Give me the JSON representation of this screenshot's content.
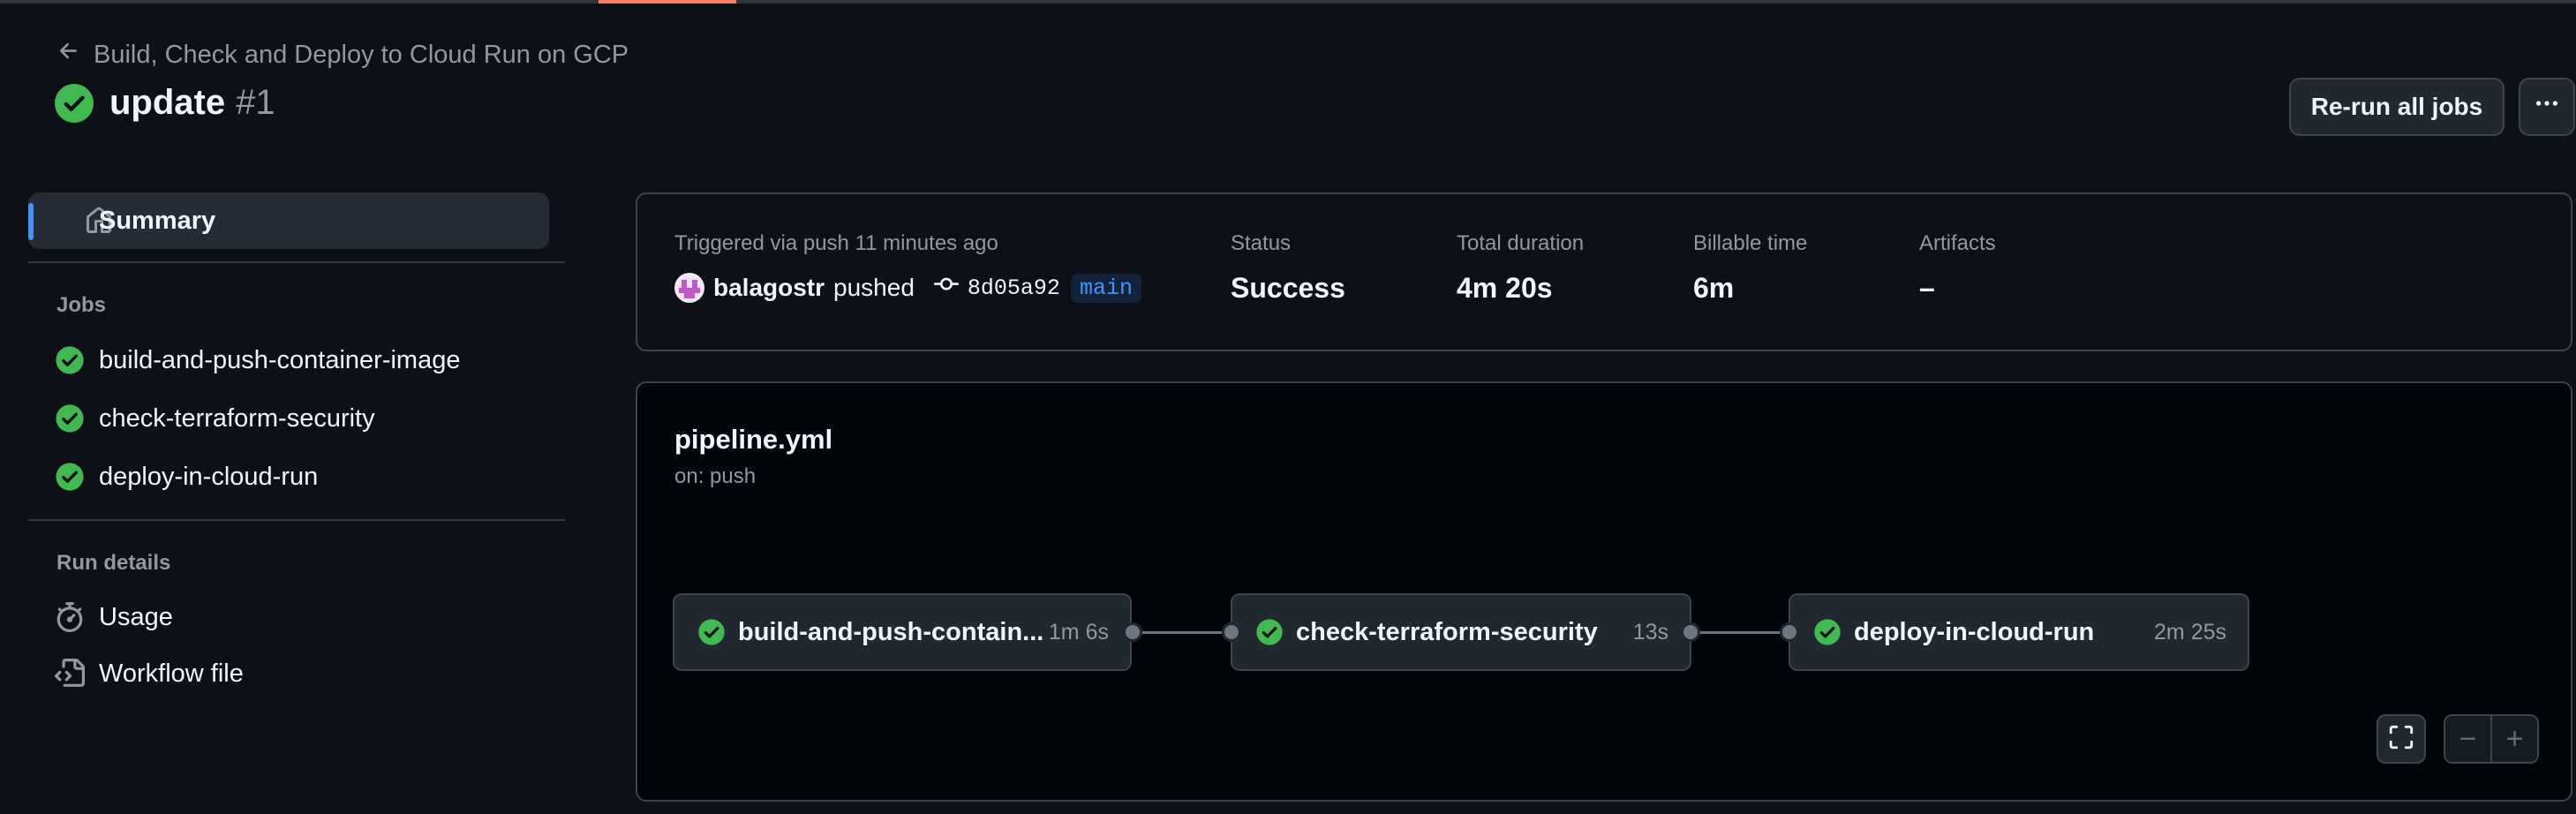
{
  "header": {
    "back_link": "Build, Check and Deploy to Cloud Run on GCP",
    "title": "update",
    "run_number": "#1",
    "rerun_label": "Re-run all jobs",
    "more_label": "···"
  },
  "sidebar": {
    "summary_label": "Summary",
    "jobs_heading": "Jobs",
    "jobs": [
      {
        "label": "build-and-push-container-image",
        "icon": "check-circle-icon"
      },
      {
        "label": "check-terraform-security",
        "icon": "check-circle-icon"
      },
      {
        "label": "deploy-in-cloud-run",
        "icon": "check-circle-icon"
      }
    ],
    "run_details_heading": "Run details",
    "run_details": [
      {
        "label": "Usage",
        "icon": "stopwatch-icon"
      },
      {
        "label": "Workflow file",
        "icon": "file-code-icon"
      }
    ]
  },
  "summary": {
    "trigger_text": "Triggered via push 11 minutes ago",
    "actor": "balagostr",
    "action": "pushed",
    "commit": "8d05a92",
    "branch": "main",
    "status_label": "Status",
    "status_value": "Success",
    "duration_label": "Total duration",
    "duration_value": "4m 20s",
    "billable_label": "Billable time",
    "billable_value": "6m",
    "artifacts_label": "Artifacts",
    "artifacts_value": "–"
  },
  "pipeline": {
    "file": "pipeline.yml",
    "trigger": "on: push",
    "jobs": [
      {
        "name": "build-and-push-contain...",
        "duration": "1m 6s"
      },
      {
        "name": "check-terraform-security",
        "duration": "13s"
      },
      {
        "name": "deploy-in-cloud-run",
        "duration": "2m 25s"
      }
    ],
    "zoom_out_label": "−",
    "zoom_in_label": "+"
  },
  "colors": {
    "success": "#3fb950",
    "accent": "#4493f8",
    "background": "#0d1117"
  }
}
